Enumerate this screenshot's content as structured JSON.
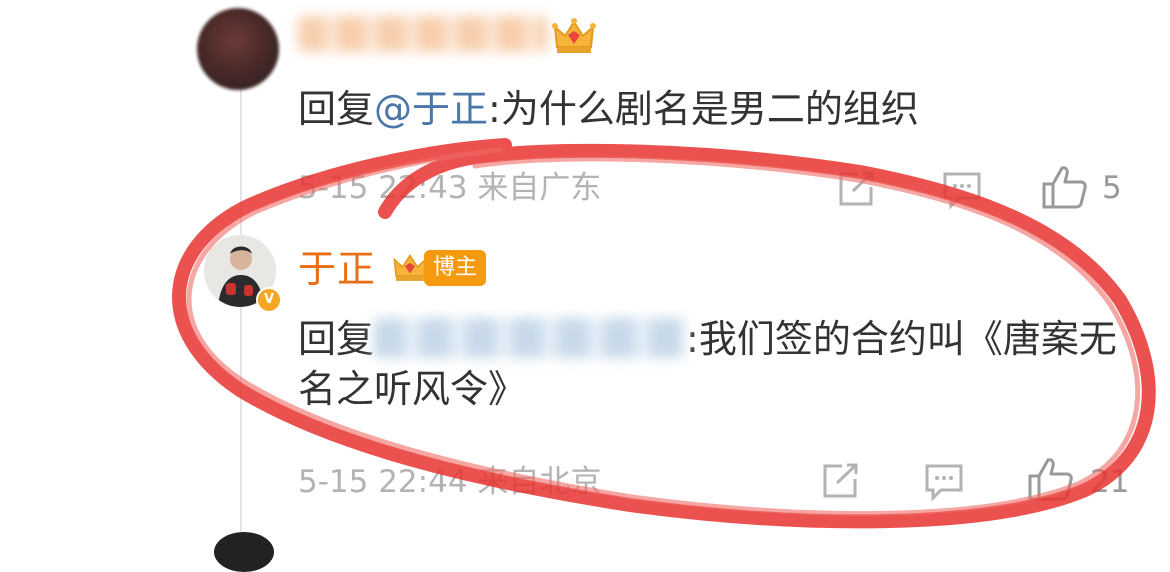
{
  "comment1": {
    "reply_prefix": "回复",
    "mention": "@于正",
    "text": ":为什么剧名是男二的组织",
    "timestamp": "5-15 22:43",
    "location": "来自广东",
    "likes": "5"
  },
  "comment2": {
    "author": "于正",
    "badge": "博主",
    "reply_prefix": "回复",
    "text": ":我们签的合约叫《唐案无名之听风令》",
    "timestamp": "5-15 22:44",
    "location": "来自北京",
    "likes": "21"
  },
  "colors": {
    "accent_orange": "#e86d17",
    "mention_blue": "#4a76a8",
    "annotation_red": "#e8332f",
    "meta_gray": "#b3b3b3"
  },
  "icons": [
    "crown-icon",
    "verified-v-icon",
    "share-icon",
    "comment-icon",
    "thumbs-up-icon"
  ]
}
